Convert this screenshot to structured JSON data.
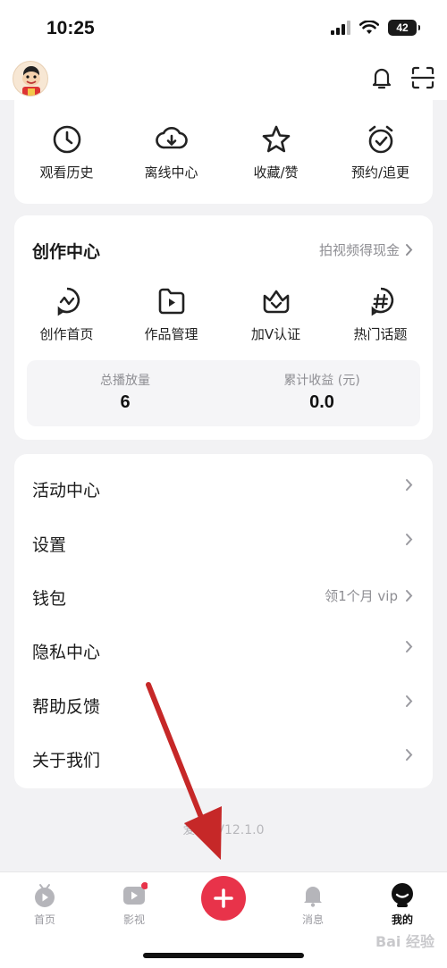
{
  "status_bar": {
    "time": "10:25",
    "battery": "42"
  },
  "header": {
    "avatar": "avatar",
    "icons": [
      "bell-icon",
      "scan-icon"
    ]
  },
  "quick_actions": [
    {
      "label": "观看历史",
      "icon": "clock-icon"
    },
    {
      "label": "离线中心",
      "icon": "download-cloud-icon"
    },
    {
      "label": "收藏/赞",
      "icon": "star-icon"
    },
    {
      "label": "预约/追更",
      "icon": "alarm-check-icon"
    }
  ],
  "creator": {
    "title": "创作中心",
    "link": "拍视频得现金",
    "items": [
      {
        "label": "创作首页",
        "icon": "creator-home-icon"
      },
      {
        "label": "作品管理",
        "icon": "play-folder-icon"
      },
      {
        "label": "加V认证",
        "icon": "verify-crown-icon"
      },
      {
        "label": "热门话题",
        "icon": "hashtag-icon"
      }
    ],
    "stats": [
      {
        "label": "总播放量",
        "value": "6"
      },
      {
        "label": "累计收益 (元)",
        "value": "0.0"
      }
    ]
  },
  "menu": [
    {
      "label": "活动中心",
      "right": ""
    },
    {
      "label": "设置",
      "right": ""
    },
    {
      "label": "钱包",
      "right": "领1个月 vip"
    },
    {
      "label": "隐私中心",
      "right": ""
    },
    {
      "label": "帮助反馈",
      "right": ""
    },
    {
      "label": "关于我们",
      "right": ""
    }
  ],
  "version": "爱 刻 V12.1.0",
  "tabs": [
    {
      "label": "首页",
      "icon": "home-tv-icon"
    },
    {
      "label": "影视",
      "icon": "video-play-icon"
    },
    {
      "label": "",
      "icon": "plus-icon"
    },
    {
      "label": "消息",
      "icon": "message-bell-icon"
    },
    {
      "label": "我的",
      "icon": "profile-icon"
    }
  ],
  "watermark": "Bai 经验",
  "colors": {
    "accent": "#e8334a",
    "arrow": "#c62828",
    "background": "#f2f2f4"
  }
}
